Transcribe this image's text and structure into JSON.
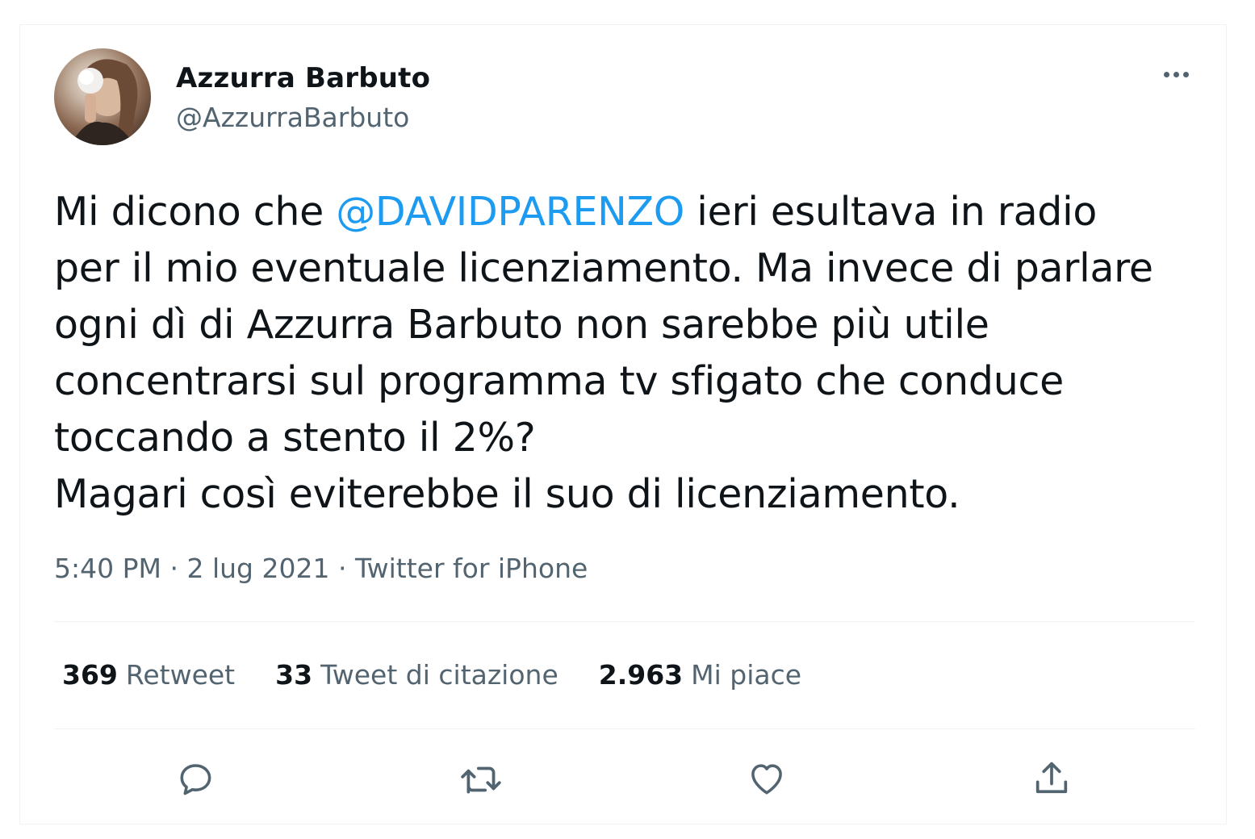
{
  "tweet": {
    "author": {
      "display_name": "Azzurra Barbuto",
      "handle": "@AzzurraBarbuto"
    },
    "text_before_mention": "Mi dicono che ",
    "mention": "@DAVIDPARENZO",
    "text_after_mention": " ieri esultava in radio\nper il mio eventuale licenziamento. Ma invece di parlare\nogni dì di Azzurra Barbuto non sarebbe più utile\nconcentrarsi sul programma tv sfigato che conduce\ntoccando a stento il 2%?\nMagari così eviterebbe il suo di licenziamento.",
    "time": "5:40 PM",
    "date": "2 lug 2021",
    "source": "Twitter for iPhone",
    "separator": " · "
  },
  "stats": {
    "retweets": {
      "count": "369",
      "label": "Retweet"
    },
    "quotes": {
      "count": "33",
      "label": "Tweet di citazione"
    },
    "likes": {
      "count": "2.963",
      "label": "Mi piace"
    }
  },
  "actions": {
    "reply_icon": "reply-icon",
    "retweet_icon": "retweet-icon",
    "like_icon": "heart-icon",
    "share_icon": "share-icon"
  },
  "colors": {
    "mention": "#1d9bf0",
    "secondary_text": "#536471",
    "primary_text": "#0f1419",
    "divider": "#eff3f4"
  }
}
